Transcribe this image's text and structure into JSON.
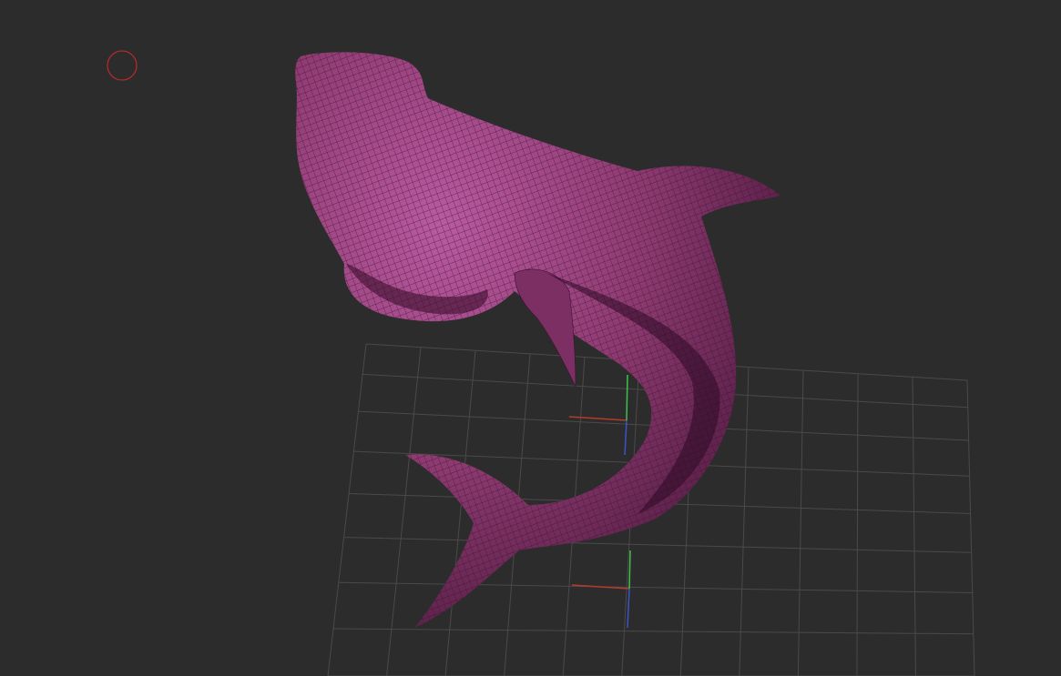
{
  "viewport": {
    "background_color": "#2c2c2c",
    "grid_color": "#4a4a4a",
    "grid_visible": true
  },
  "model": {
    "name": "shark-mesh",
    "color": "#a0457f",
    "wireframe_color": "#3a1030",
    "wireframe_visible": true
  },
  "cursor": {
    "icon": "brush-circle-icon",
    "color": "#b52a2a"
  },
  "gizmos": [
    {
      "icon": "axis-gizmo-icon",
      "x_color": "#b83a2a",
      "y_color": "#3cc24a",
      "z_color": "#3a55c8"
    },
    {
      "icon": "axis-gizmo-icon",
      "x_color": "#b83a2a",
      "y_color": "#3cc24a",
      "z_color": "#3a55c8"
    }
  ]
}
